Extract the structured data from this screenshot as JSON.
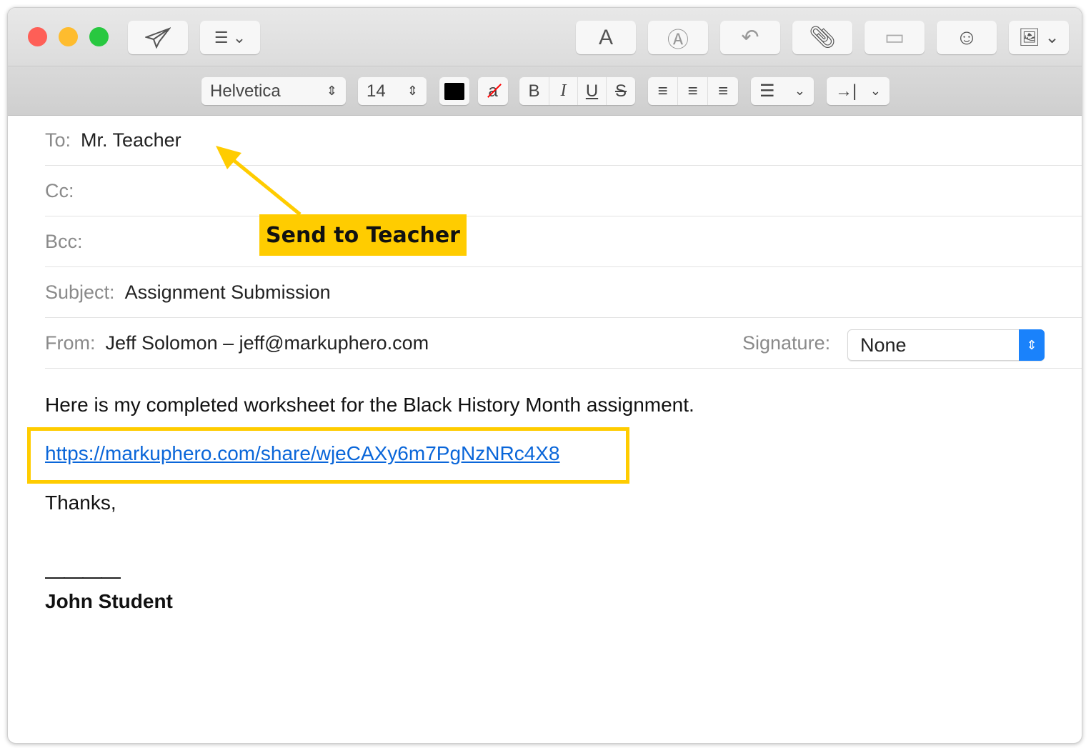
{
  "toolbar": {
    "send": "send-icon",
    "list": "list-icon",
    "font_panel": "A",
    "colors": {
      "close": "#fe5f57",
      "minimize": "#febc2e",
      "zoom": "#28c840"
    }
  },
  "format": {
    "font": "Helvetica",
    "size": "14",
    "bold": "B",
    "italic": "I",
    "underline": "U",
    "strike": "S"
  },
  "header": {
    "to_label": "To:",
    "to_value": "Mr. Teacher",
    "cc_label": "Cc:",
    "bcc_label": "Bcc:",
    "subject_label": "Subject:",
    "subject_value": "Assignment Submission",
    "from_label": "From:",
    "from_value": "Jeff Solomon – jeff@markuphero.com",
    "signature_label": "Signature:",
    "signature_value": "None"
  },
  "message": {
    "line1": "Here is my completed worksheet for the Black History Month assignment.",
    "link": "https://markuphero.com/share/wjeCAXy6m7PgNzNRc4X8",
    "thanks": "Thanks,",
    "dashes": "————",
    "signature": "John Student"
  },
  "annotation": {
    "callout": "Send to Teacher",
    "color": "#ffcc00"
  }
}
